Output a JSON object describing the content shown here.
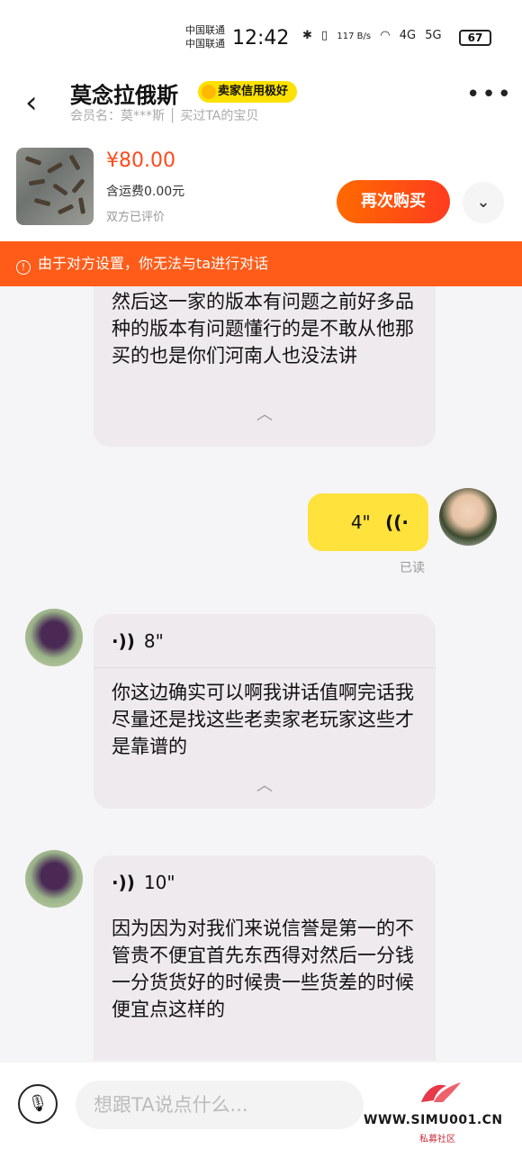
{
  "status_bar": {
    "carrier1": "中国联通",
    "carrier2": "中国联通",
    "time": "12:42",
    "speed": "117 B/s",
    "net1": "4G",
    "net2": "5G",
    "battery": "67"
  },
  "header": {
    "seller_name": "莫念拉俄斯",
    "credit_badge": "卖家信用极好",
    "member_info": "会员名：莫***斯 │ 买过TA的宝贝"
  },
  "product": {
    "price": "¥80.00",
    "shipping": "含运费0.00元",
    "review_status": "双方已评价",
    "rebuy_label": "再次购买"
  },
  "notice": {
    "text": "由于对方设置，你无法与ta进行对话"
  },
  "messages": {
    "first_text": "然后这一家的版本有问题之前好多品种的版本有问题懂行的是不敢从他那买的也是你们河南人也没法讲",
    "my_voice_duration": "4\"",
    "read_label": "已读",
    "second_duration": "8\"",
    "second_text": "你这边确实可以啊我讲话值啊完话我尽量还是找这些老卖家老玩家这些才是靠谱的",
    "third_duration": "10\"",
    "third_text": "因为因为对我们来说信誉是第一的不管贵不便宜首先东西得对然后一分钱一分货货好的时候贵一些货差的时候便宜点这样的"
  },
  "input": {
    "placeholder": "想跟TA说点什么..."
  },
  "watermark": {
    "site": "WWW.SIMU001.CN",
    "sub": "私募社区"
  },
  "colors": {
    "accent_orange": "#ff5c1a",
    "price_red": "#ff4a1c",
    "my_bubble": "#ffe23b",
    "badge_yellow": "#fde100"
  }
}
